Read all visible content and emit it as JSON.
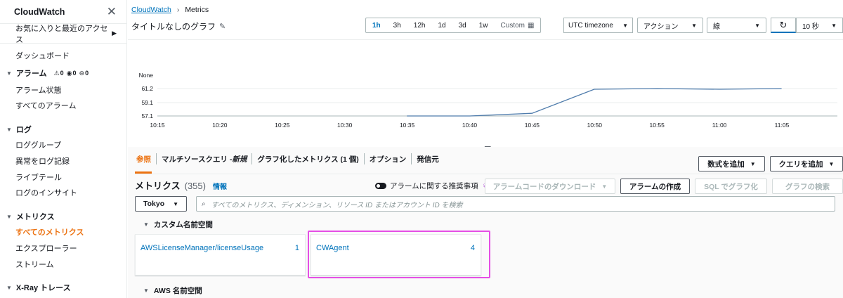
{
  "sidebar": {
    "title": "CloudWatch",
    "favorites": "お気に入りと最近のアクセス",
    "dashboard": "ダッシュボード",
    "alarms": {
      "label": "アラーム",
      "alarm_count": "0",
      "ok_count": "0",
      "insufficient_count": "0"
    },
    "alarm_state": "アラーム状態",
    "all_alarms": "すべてのアラーム",
    "logs": "ログ",
    "log_groups": "ロググループ",
    "log_anomaly": "異常をログ記録",
    "live_tail": "ライブテール",
    "log_insights": "ログのインサイト",
    "metrics": "メトリクス",
    "all_metrics": "すべてのメトリクス",
    "explorer": "エクスプローラー",
    "streams": "ストリーム",
    "xray": "X-Ray トレース"
  },
  "breadcrumb": {
    "home": "CloudWatch",
    "current": "Metrics"
  },
  "graph": {
    "title": "タイトルなしのグラフ",
    "ranges": [
      "1h",
      "3h",
      "12h",
      "1d",
      "3d",
      "1w"
    ],
    "selected_range": "1h",
    "custom": "Custom",
    "timezone": "UTC timezone",
    "actions": "アクション",
    "graph_type": "線",
    "interval": "10 秒"
  },
  "chart_data": {
    "type": "line",
    "y_top_label": "None",
    "yticks": [
      61.2,
      59.1,
      57.1
    ],
    "x": [
      "10:15",
      "10:20",
      "10:25",
      "10:30",
      "10:35",
      "10:40",
      "10:45",
      "10:50",
      "10:55",
      "11:00",
      "11:05"
    ],
    "series": [
      {
        "points": [
          [
            10.583,
            57.1
          ],
          [
            10.667,
            57.1
          ],
          [
            10.75,
            57.5
          ],
          [
            10.833,
            61.1
          ],
          [
            10.917,
            61.2
          ],
          [
            11.0,
            61.1
          ],
          [
            11.083,
            61.2
          ]
        ]
      }
    ],
    "ylim": [
      57.1,
      61.2
    ],
    "grid": true,
    "color": "#4f7cac"
  },
  "tabs": {
    "browse": "参照",
    "multisource": "マルチソースクエリ - ",
    "multisource_new": "新規",
    "graphed": "グラフ化したメトリクス (1 個)",
    "options": "オプション",
    "source": "発信元"
  },
  "buttons": {
    "add_math": "数式を追加",
    "add_query": "クエリを追加",
    "download_alarm": "アラームコードのダウンロード",
    "create_alarm": "アラームの作成",
    "sql_graph": "SQL でグラフ化",
    "graph_search": "グラフの検索"
  },
  "metrics": {
    "title": "メトリクス",
    "count": "(355)",
    "info": "情報",
    "recommend_toggle": "アラームに関する推奨事項",
    "region": "Tokyo",
    "search_placeholder": "すべてのメトリクス、ディメンション、リソース ID またはアカウント ID を検索"
  },
  "namespaces": {
    "custom_label": "カスタム名前空間",
    "custom": [
      {
        "name": "AWSLicenseManager/licenseUsage",
        "count": "1"
      },
      {
        "name": "CWAgent",
        "count": "4"
      }
    ],
    "aws_label": "AWS 名前空間"
  }
}
